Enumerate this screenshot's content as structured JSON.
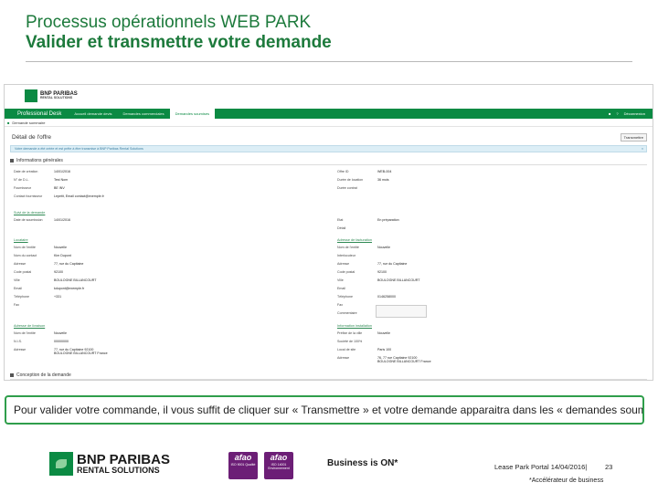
{
  "slide": {
    "title_line1": "Processus opérationnels WEB PARK",
    "title_line2": "Valider et transmettre votre demande",
    "callout": "Pour valider votre commande, il vous suffit de cliquer sur « Transmettre » et votre demande apparaitra dans les « demandes soumises ».",
    "footer_left": "Lease Park Portal  14/04/2016|",
    "page_number": "23",
    "footnote": "*Accélérateur de business",
    "slogan": "Business is ON*",
    "brand_line1": "BNP PARIBAS",
    "brand_line2": "RENTAL SOLUTIONS",
    "badges": [
      {
        "name": "afao",
        "sub": "ISO 9001 Qualité"
      },
      {
        "name": "afao",
        "sub": "ISO 14001 Environnement"
      }
    ]
  },
  "app": {
    "logo_line1": "BNP PARIBAS",
    "logo_line2": "RENTAL SOLUTIONS",
    "nav_brand": "Professional Desk",
    "tabs": [
      "Accueil demande devis",
      "Demandes commerciales",
      "Demandes soumises"
    ],
    "nav_right": [
      "■",
      "?",
      "Déconnexion"
    ],
    "breadcrumb": "Demande sommaire",
    "detail_title": "Détail de l'offre",
    "action_button": "Transmettre",
    "banner": "Votre demande a été créée et est prête à être transmise à BNP Paribas Rental Solutions",
    "sections": [
      "Informations générales",
      "Conception de la demande"
    ],
    "general_left": [
      {
        "k": "Date de création",
        "v": "14/01/2016"
      },
      {
        "k": "N° de D.L.",
        "v": "Test Nom"
      },
      {
        "k": "Fournisseur",
        "v": "BE INV"
      },
      {
        "k": "Contact fournisseur",
        "v": "Lepetit, Email contact@exemple.fr"
      }
    ],
    "general_right": [
      {
        "k": "Offre ID",
        "v": "WEB-004"
      },
      {
        "k": "Durée de location",
        "v": "36 mois"
      },
      {
        "k": "Durée contrat",
        "v": ""
      }
    ],
    "suivi_title": "Suivi de la demande",
    "suivi_left": [
      {
        "k": "Date de soumission",
        "v": "14/01/2016"
      }
    ],
    "suivi_right": [
      {
        "k": "Etat",
        "v": "En préparation"
      },
      {
        "k": "Détail",
        "v": ""
      }
    ],
    "locataire_title": "Locataire",
    "locataire_rows": [
      {
        "k": "Nom de l'entité",
        "v": "Nouvelle"
      },
      {
        "k": "Nom du contact",
        "v": "Kim Dupont"
      },
      {
        "k": "Adresse",
        "v": "77, rue du Capitaine"
      },
      {
        "k": "Code postal",
        "v": "92100"
      },
      {
        "k": "Ville",
        "v": "BOULOGNE BILLANCOURT"
      },
      {
        "k": "Email",
        "v": "kdupont@exemple.fr"
      },
      {
        "k": "Téléphone",
        "v": "+331"
      },
      {
        "k": "Fax",
        "v": ""
      }
    ],
    "facturation_title": "Adresse de facturation",
    "facturation_rows": [
      {
        "k": "Nom de l'entité",
        "v": "Nouvelle"
      },
      {
        "k": "Interlocuteur",
        "v": ""
      },
      {
        "k": "Adresse",
        "v": "77, rue du Capitaine"
      },
      {
        "k": "Code postal",
        "v": "92100"
      },
      {
        "k": "Ville",
        "v": "BOULOGNE BILLANCOURT"
      },
      {
        "k": "Email",
        "v": ""
      },
      {
        "k": "Téléphone",
        "v": "0146258000"
      },
      {
        "k": "Fax",
        "v": ""
      },
      {
        "k": "Commentaire",
        "v": ""
      }
    ],
    "livraison_title": "Adresse de livraison",
    "livraison_rows": [
      {
        "k": "Nom de l'entité",
        "v": "Nouvelle"
      },
      {
        "k": "N.I.S.",
        "v": "00000000"
      },
      {
        "k": "Adresse",
        "v": "77, rue du Capitaine 92100 BOULOGNE BILLANCOURT France"
      }
    ],
    "install_title": "Information installation",
    "install_rows": [
      {
        "k": "Préfixe de la ville",
        "v": "Nouvelle"
      },
      {
        "k": "Société de 100%",
        "v": ""
      },
      {
        "k": "Local de site",
        "v": "Paris 100"
      },
      {
        "k": "Adresse",
        "v": "76, 77 rue Capitaine 92100 BOULOGNE BILLANCOURT France"
      }
    ]
  }
}
